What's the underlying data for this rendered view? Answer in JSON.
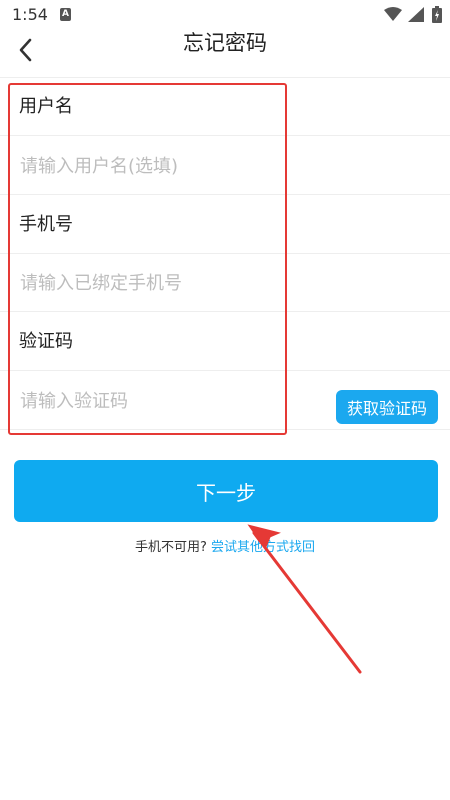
{
  "status_bar": {
    "time": "1:54",
    "badge_letter": "A"
  },
  "header": {
    "title": "忘记密码"
  },
  "form": {
    "username": {
      "label": "用户名",
      "placeholder": "请输入用户名(选填)"
    },
    "phone": {
      "label": "手机号",
      "placeholder": "请输入已绑定手机号"
    },
    "code": {
      "label": "验证码",
      "placeholder": "请输入验证码",
      "button_label": "获取验证码"
    }
  },
  "actions": {
    "next_label": "下一步",
    "alt_text": "手机不可用?",
    "alt_link": "尝试其他方式找回"
  },
  "colors": {
    "accent": "#0faaf0",
    "highlight": "#e53935",
    "link": "#1ba8ef"
  },
  "icons": {
    "back": "chevron-left-icon",
    "wifi": "wifi-icon",
    "signal": "signal-icon",
    "battery": "battery-icon"
  }
}
